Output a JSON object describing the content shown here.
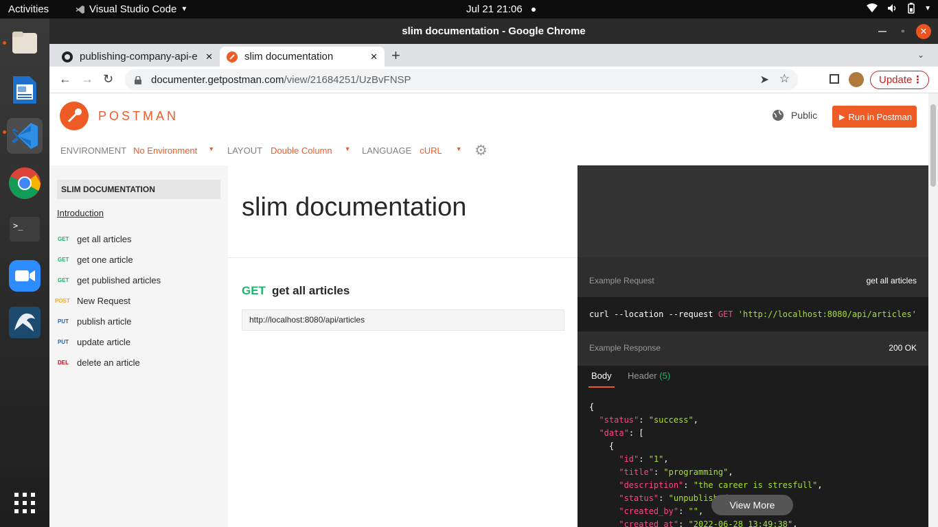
{
  "topbar": {
    "activities": "Activities",
    "app_name": "Visual Studio Code",
    "clock": "Jul 21  21:06"
  },
  "window": {
    "title": "slim documentation - Google Chrome"
  },
  "tabs": [
    {
      "label": "publishing-company-api-e"
    },
    {
      "label": "slim documentation"
    }
  ],
  "address": {
    "host": "documenter.getpostman.com",
    "path": "/view/21684251/UzBvFNSP"
  },
  "toolbar": {
    "update_label": "Update"
  },
  "postman": {
    "brand": "POSTMAN",
    "visibility": "Public",
    "run_button": "Run in Postman",
    "env_label": "ENVIRONMENT",
    "env_value": "No Environment",
    "layout_label": "LAYOUT",
    "layout_value": "Double Column",
    "language_label": "LANGUAGE",
    "language_value": "cURL"
  },
  "sidebar": {
    "heading": "SLIM DOCUMENTATION",
    "intro": "Introduction",
    "items": [
      {
        "method": "GET",
        "label": "get all articles",
        "color": "#1fb46c"
      },
      {
        "method": "GET",
        "label": "get one article",
        "color": "#1fb46c"
      },
      {
        "method": "GET",
        "label": "get published articles",
        "color": "#1fb46c"
      },
      {
        "method": "POST",
        "label": "New Request",
        "color": "#f5a623"
      },
      {
        "method": "PUT",
        "label": "publish article",
        "color": "#1f5cb4"
      },
      {
        "method": "PUT",
        "label": "update article",
        "color": "#1f5cb4"
      },
      {
        "method": "DEL",
        "label": "delete an article",
        "color": "#d0021b"
      }
    ]
  },
  "main": {
    "title": "slim documentation",
    "request_method": "GET",
    "request_name": "get all articles",
    "url": "http://localhost:8080/api/articles"
  },
  "example": {
    "request_label": "Example Request",
    "request_name": "get all articles",
    "curl_prefix": "curl --location --request ",
    "curl_method": "GET",
    "curl_url": "'http://localhost:8080/api/articles'",
    "response_label": "Example Response",
    "status": "200 OK",
    "tab_body": "Body",
    "tab_header": "Header",
    "header_count": "(5)",
    "view_more": "View More"
  },
  "json_lines": [
    "{",
    "  \"status\": \"success\",",
    "  \"data\": [",
    "    {",
    "      \"id\": \"1\",",
    "      \"title\": \"programming\",",
    "      \"description\": \"the career is stresfull\",",
    "      \"status\": \"unpublished\",",
    "      \"created_by\": \"\",",
    "      \"created_at\": \"2022-06-28 13:49:38\","
  ],
  "colors": {
    "accent": "#ef5b25",
    "get": "#1fb46c",
    "json_key": "#ff4488",
    "json_string": "#a6e22e"
  }
}
